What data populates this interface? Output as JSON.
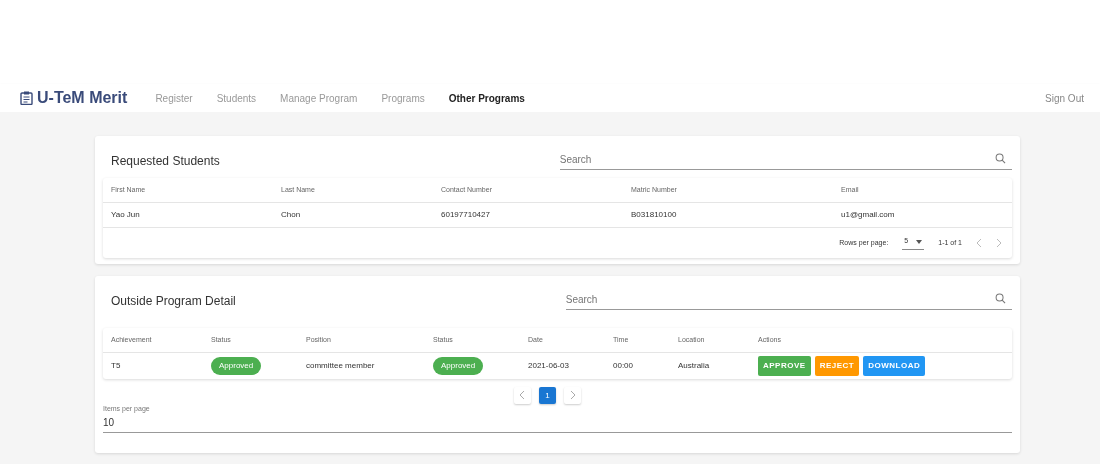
{
  "navbar": {
    "brand": "U-TeM Merit",
    "items": [
      {
        "label": "Register",
        "selected": false
      },
      {
        "label": "Students",
        "selected": false
      },
      {
        "label": "Manage Program",
        "selected": false
      },
      {
        "label": "Programs",
        "selected": false
      },
      {
        "label": "Other Programs",
        "selected": true
      }
    ],
    "sign_out": "Sign Out"
  },
  "requested_students": {
    "title": "Requested Students",
    "search": {
      "placeholder": "Search"
    },
    "columns": [
      "First Name",
      "Last Name",
      "Contact Number",
      "Matric Number",
      "Email"
    ],
    "rows": [
      [
        "Yao Jun",
        "Chon",
        "60197710427",
        "B031810100",
        "u1@gmail.com"
      ]
    ],
    "footer": {
      "rows_per_page_label": "Rows per page:",
      "rows_per_page": "5",
      "range": "1-1 of 1"
    }
  },
  "outside_program_detail": {
    "title": "Outside Program Detail",
    "search": {
      "placeholder": "Search"
    },
    "columns": [
      "Achievement",
      "Status",
      "Position",
      "Status",
      "Date",
      "Time",
      "Location",
      "Actions"
    ],
    "rows": [
      {
        "achievement": "T5",
        "status": "Approved",
        "position": "committee member",
        "status_2": "Approved",
        "date": "2021-06-03",
        "time": "00:00",
        "location": "Australia",
        "actions": [
          {
            "label": "APPROVE",
            "kind": "approve"
          },
          {
            "label": "REJECT",
            "kind": "reject"
          },
          {
            "label": "DOWNLOAD",
            "kind": "download"
          }
        ]
      }
    ],
    "pagination": {
      "pages": [
        {
          "label": "1",
          "selected": true
        }
      ]
    },
    "items_per_page": {
      "label": "Items per page",
      "value": "10"
    }
  }
}
